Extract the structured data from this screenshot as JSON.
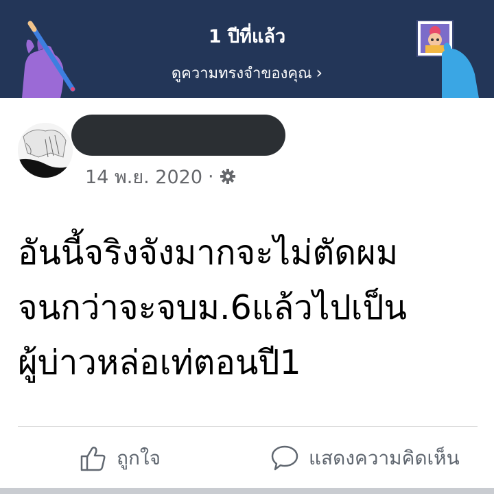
{
  "memory_banner": {
    "title": "1 ปีที่แล้ว",
    "link_label": "ดูความทรงจำของคุณ",
    "chevron_icon": "chevron-right-icon",
    "background_color": "#233658"
  },
  "post": {
    "date": "14 พ.ย. 2020",
    "separator": "·",
    "privacy_icon": "gear-icon",
    "text": "อันนี้จริงจังมากจะไม่ตัดผม\nจนกว่าจะจบม.6แล้วไปเป็น\nผู้บ่าวหล่อเท่ตอนปี1"
  },
  "actions": {
    "like_label": "ถูกใจ",
    "comment_label": "แสดงความคิดเห็น"
  }
}
